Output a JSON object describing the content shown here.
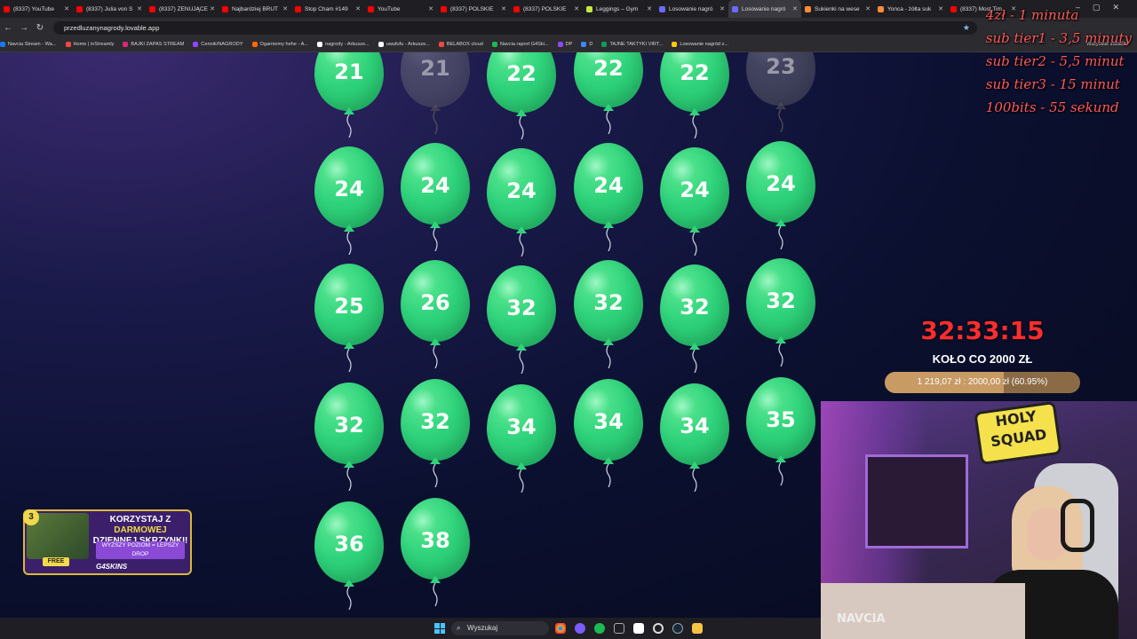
{
  "browser": {
    "tabs": [
      {
        "label": "(8337) YouTube",
        "color": "#ff0000",
        "active": false
      },
      {
        "label": "(8337) Julia von S",
        "color": "#ff0000",
        "active": false
      },
      {
        "label": "(8337) ŻENUJĄCE",
        "color": "#ff0000",
        "active": false
      },
      {
        "label": "Najbardziej BRUT",
        "color": "#ff0000",
        "active": false
      },
      {
        "label": "Stop Cham #149",
        "color": "#ff0000",
        "active": false
      },
      {
        "label": "YouTube",
        "color": "#ff0000",
        "active": false
      },
      {
        "label": "(8337) POLSKIE",
        "color": "#ff0000",
        "active": false
      },
      {
        "label": "(8337) POLSKIE",
        "color": "#ff0000",
        "active": false
      },
      {
        "label": "Leggings – Gym",
        "color": "#c6e93a",
        "active": false
      },
      {
        "label": "Losowanie nagró",
        "color": "#6b6bff",
        "active": false
      },
      {
        "label": "Losowanie nagró",
        "color": "#6b6bff",
        "active": true
      },
      {
        "label": "Sukienki na wese",
        "color": "#ff8a3a",
        "active": false
      },
      {
        "label": "Yonca - żółta suk",
        "color": "#ff8a3a",
        "active": false
      },
      {
        "label": "(8337) Most Tim",
        "color": "#ff0000",
        "active": false
      }
    ],
    "url": "przedluzanynagrody.lovable.app",
    "bookmarks": [
      "Navcia Stream - Wa...",
      "Home | inStreamly",
      "BAJKI ZAPAS STREAM",
      "Cennik/NAGRODY",
      "Ogarniemy hehe - A...",
      "nagrody - Arkusze...",
      "uwufufu - Arkusze...",
      "BELABOX cloud",
      "Navcia raport G4Ski...",
      "DP",
      "D",
      "TAJNE TAKTYKI VIRT...",
      "Losowanie nagród z..."
    ],
    "bookmarks_all": "Wszystkie zakładki"
  },
  "balloons": [
    {
      "value": "21",
      "state": "active"
    },
    {
      "value": "21",
      "state": "dim"
    },
    {
      "value": "22",
      "state": "active"
    },
    {
      "value": "22",
      "state": "active"
    },
    {
      "value": "22",
      "state": "active"
    },
    {
      "value": "23",
      "state": "dim"
    },
    {
      "value": "24",
      "state": "active"
    },
    {
      "value": "24",
      "state": "active"
    },
    {
      "value": "24",
      "state": "active"
    },
    {
      "value": "24",
      "state": "active"
    },
    {
      "value": "24",
      "state": "active"
    },
    {
      "value": "24",
      "state": "active"
    },
    {
      "value": "25",
      "state": "active"
    },
    {
      "value": "26",
      "state": "active"
    },
    {
      "value": "32",
      "state": "active"
    },
    {
      "value": "32",
      "state": "active"
    },
    {
      "value": "32",
      "state": "active"
    },
    {
      "value": "32",
      "state": "active"
    },
    {
      "value": "32",
      "state": "active"
    },
    {
      "value": "32",
      "state": "active"
    },
    {
      "value": "34",
      "state": "active"
    },
    {
      "value": "34",
      "state": "active"
    },
    {
      "value": "34",
      "state": "active"
    },
    {
      "value": "35",
      "state": "active"
    },
    {
      "value": "36",
      "state": "active"
    },
    {
      "value": "38",
      "state": "active"
    }
  ],
  "rates": [
    "4zł - 1 minuta",
    "sub tier1 - 3,5 minuty",
    "sub tier2 - 5,5 minut",
    "sub tier3 - 15 minut",
    "100bits - 55 sekund"
  ],
  "timer": {
    "value": "32:33:15",
    "wheel_label": "KOŁO CO 2000 ZŁ",
    "progress_text": "1 219,07 zł  :  2000,00 zł (60.95%)",
    "progress_fraction": 0.6095
  },
  "webcam": {
    "badge_line1": "HOLY",
    "badge_line2": "SQUAD",
    "nick": "NAVCIA"
  },
  "promo": {
    "level": "3",
    "line1_a": "KORZYSTAJ Z ",
    "line1_b": "DARMOWEJ",
    "line2": "DZIENNEJ SKRZYNKI!",
    "sub": "WYŻSZY POZIOM = LEPSZY DROP",
    "free": "FREE",
    "brand": "G4SKINS"
  },
  "taskbar": {
    "search_placeholder": "Wyszukaj"
  },
  "colors": {
    "balloon": "#2fd37b",
    "timer": "#ff2d2d",
    "rates": "#ff5a5a"
  }
}
